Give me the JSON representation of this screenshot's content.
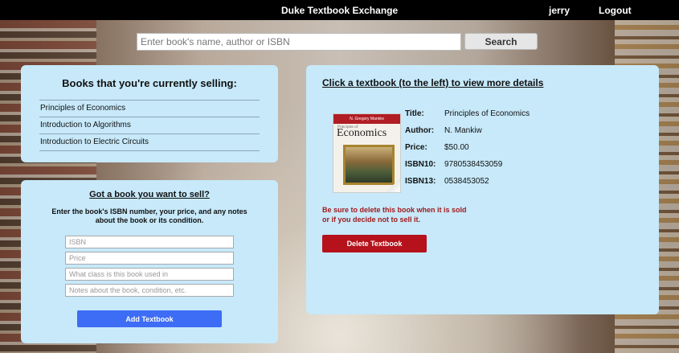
{
  "header": {
    "site_title": "Duke Textbook Exchange",
    "username": "jerry",
    "logout_label": "Logout"
  },
  "search": {
    "placeholder": "Enter book's name, author or ISBN",
    "value": "",
    "button_label": "Search"
  },
  "selling": {
    "title": "Books that you're currently selling:",
    "books": [
      "Principles of Economics",
      "Introduction to Algorithms",
      "Introduction to Electric Circuits"
    ]
  },
  "sell_form": {
    "title": "Got a book you want to sell?",
    "instructions": "Enter the book's ISBN number, your price, and any notes about the book or its condition.",
    "isbn_placeholder": "ISBN",
    "price_placeholder": "Price",
    "class_placeholder": "What class is this book used in",
    "notes_placeholder": "Notes about the book, condition, etc.",
    "submit_label": "Add Textbook"
  },
  "details": {
    "title": "Click a textbook (to the left) to view more details",
    "cover": {
      "author_line": "N. Gregory Mankiw",
      "subtitle": "Principles of",
      "title": "Economics"
    },
    "fields": [
      {
        "label": "Title:",
        "value": "Principles of Economics"
      },
      {
        "label": "Author:",
        "value": "N. Mankiw"
      },
      {
        "label": "Price:",
        "value": "$50.00"
      },
      {
        "label": "ISBN10:",
        "value": "9780538453059"
      },
      {
        "label": "ISBN13:",
        "value": "0538453052"
      }
    ],
    "warning_line1": "Be sure to delete this book when it is sold",
    "warning_line2": "or if you decide not to sell it.",
    "delete_label": "Delete Textbook"
  },
  "colors": {
    "topbar": "#000000",
    "panel": "#c7e9fa",
    "add_button": "#3d6cf5",
    "delete_button": "#b5121b",
    "warning_text": "#a11a1a"
  }
}
